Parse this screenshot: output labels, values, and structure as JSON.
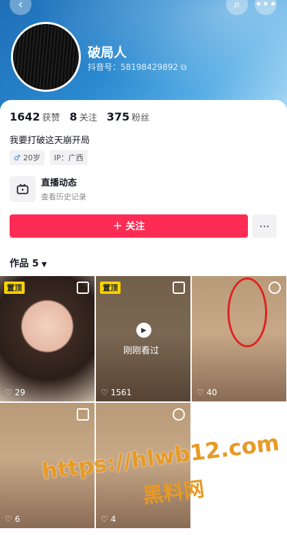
{
  "header": {
    "back_icon": "chevron-left-icon",
    "search_icon": "search-icon",
    "more_icon": "more-icon"
  },
  "profile": {
    "name": "破局人",
    "uid": "抖音号：58198429892"
  },
  "stats": [
    {
      "value": "1642",
      "label": "获赞"
    },
    {
      "value": "8",
      "label": "关注"
    },
    {
      "value": "375",
      "label": "粉丝"
    }
  ],
  "bio": "我要打破这天崩开局",
  "tags": {
    "age": "20岁",
    "ip": "IP：广西"
  },
  "live": {
    "title": "直播动态",
    "subtitle": "查看历史记录"
  },
  "actions": {
    "follow": "＋ 关注",
    "more": "···"
  },
  "works": {
    "label": "作品 5"
  },
  "tiles": [
    {
      "pin": "置顶",
      "likes": "29"
    },
    {
      "pin": "置顶",
      "likes": "1561",
      "overlay": "刚刚看过"
    },
    {
      "likes": "40"
    },
    {
      "likes": "6"
    },
    {
      "likes": "4"
    }
  ],
  "watermark": {
    "url": "https://hlwb12.com",
    "brand": "黑料网"
  },
  "colors": {
    "accent": "#fe2c55",
    "pin": "#f8d200",
    "watermark": "#e79a25"
  }
}
